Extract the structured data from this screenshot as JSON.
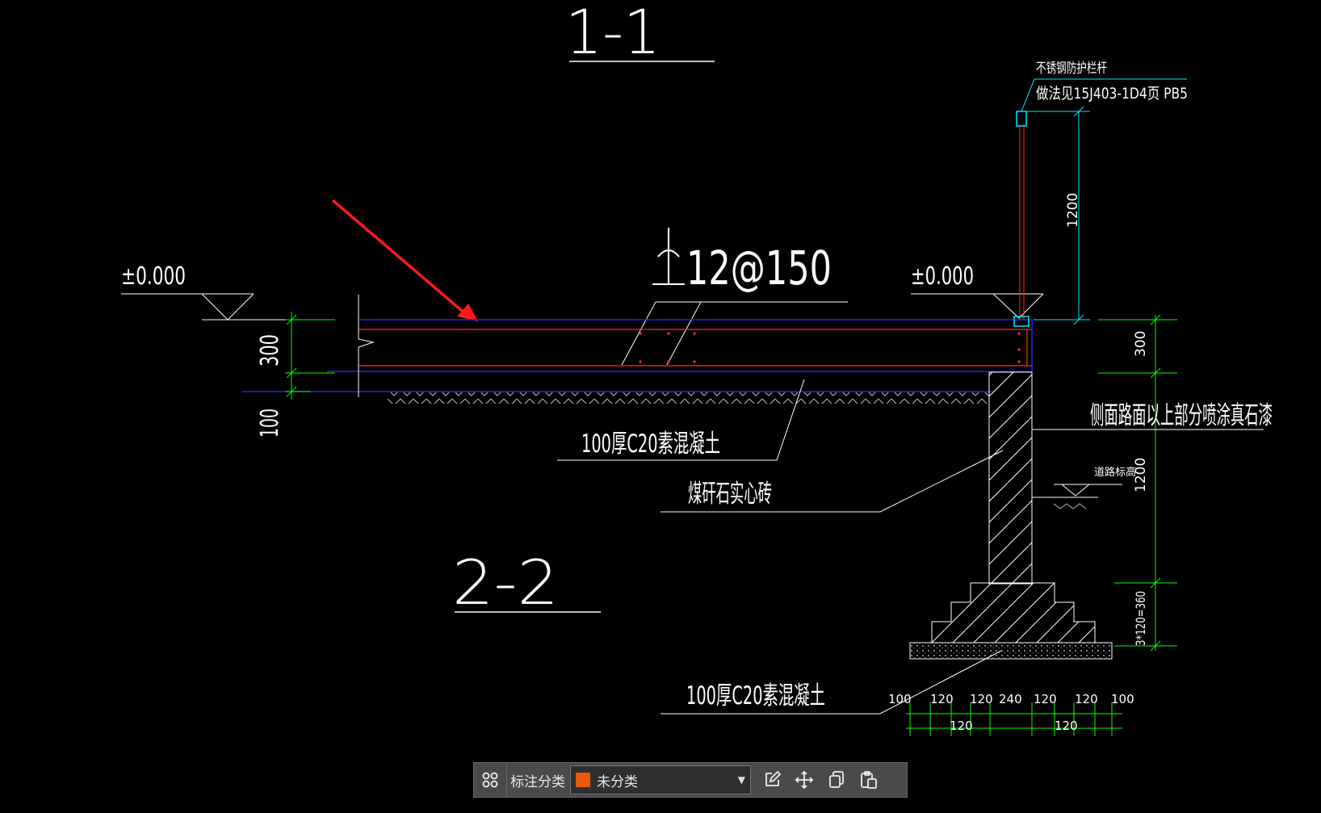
{
  "drawing": {
    "section_1": "1-1",
    "section_2": "2-2",
    "rebar": "12@150",
    "elev_left": "±0.000",
    "elev_right": "±0.000",
    "railing_line1": "不锈钢防护栏杆",
    "railing_line2": "做法见15J403-1D4页 PB5",
    "dim_300_left": "300",
    "dim_100_left": "100",
    "dim_1200_top": "1200",
    "dim_300_right": "300",
    "dim_1200_right": "1200",
    "dim_3x120": "3*120=360",
    "note_side": "侧面路面以上部分喷涂真石漆",
    "note_road": "道路标高",
    "note_concrete_1": "100厚C20素混凝土",
    "note_brick": "煤矸石实心砖",
    "note_concrete_2": "100厚C20素混凝土",
    "bottom_dims_top": [
      "100",
      "120",
      "120",
      "240",
      "120",
      "120",
      "100"
    ],
    "bottom_dims_low": [
      "120",
      "120"
    ]
  },
  "colors": {
    "dim_green": "#00ff00",
    "slab_red": "#ff2a2a",
    "line_blue": "#2020ff",
    "rail_cyan": "#00e5ff",
    "arrow_red": "#ff1a1a",
    "swatch": "#e8590c"
  },
  "toolbar": {
    "icons": [
      "grid-icon",
      "edit-icon",
      "move-icon",
      "copy-icon",
      "paste-icon"
    ],
    "label": "标注分类",
    "select_value": "未分类"
  }
}
